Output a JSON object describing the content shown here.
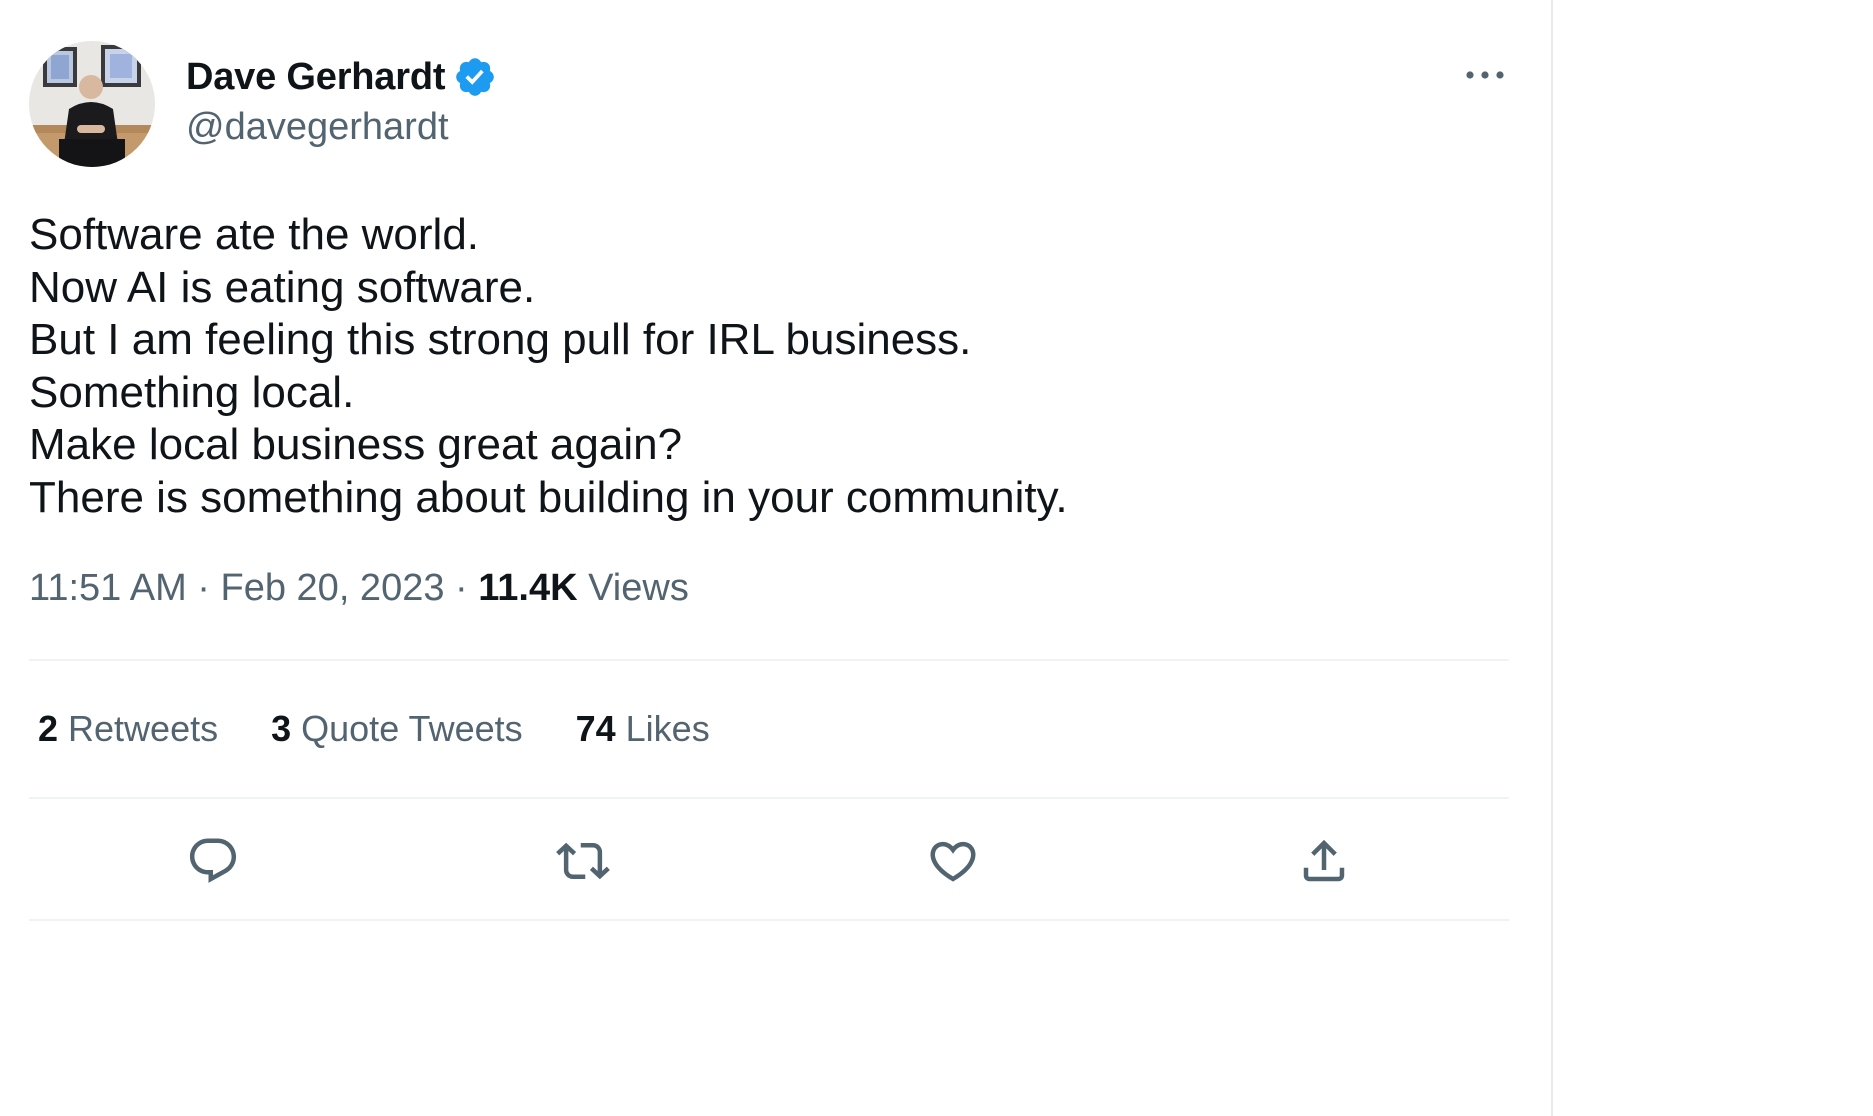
{
  "author": {
    "display_name": "Dave Gerhardt",
    "handle": "@davegerhardt",
    "verified": true,
    "verified_color": "#1d9bf0"
  },
  "tweet": {
    "lines": [
      "Software ate the world.",
      "Now AI is eating software.",
      "But I am feeling this strong pull for IRL business.",
      "Something local.",
      "Make local business great again?",
      "There is something about building in your community."
    ]
  },
  "meta": {
    "time": "11:51 AM",
    "date": "Feb 20, 2023",
    "separator": "·",
    "views_count": "11.4K",
    "views_label": "Views"
  },
  "stats": {
    "retweets": {
      "count": "2",
      "label": "Retweets"
    },
    "quote_tweets": {
      "count": "3",
      "label": "Quote Tweets"
    },
    "likes": {
      "count": "74",
      "label": "Likes"
    }
  },
  "actions": [
    {
      "name": "reply",
      "icon": "reply-icon"
    },
    {
      "name": "retweet",
      "icon": "retweet-icon"
    },
    {
      "name": "like",
      "icon": "heart-icon"
    },
    {
      "name": "share",
      "icon": "share-icon"
    }
  ],
  "colors": {
    "text_primary": "#0f1419",
    "text_secondary": "#536471",
    "divider": "#eff3f4"
  }
}
